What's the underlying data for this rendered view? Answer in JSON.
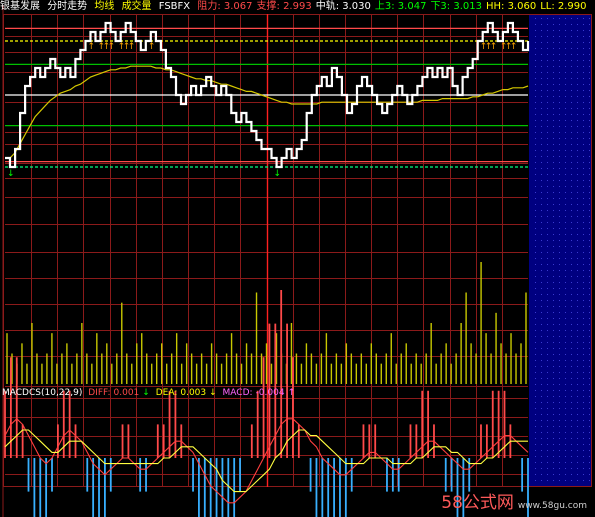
{
  "header": {
    "title": "银基发展",
    "tab_intraday": "分时走势",
    "ma_label": "均线",
    "volume_label": "成交量",
    "indicator_name": "FSBFX",
    "items": [
      {
        "label": "阻力:",
        "value": "3.067",
        "color": "#ff4a4a"
      },
      {
        "label": "支撑:",
        "value": "2.993",
        "color": "#ff4a4a"
      },
      {
        "label": "中轨:",
        "value": "3.030",
        "color": "#ffffff"
      },
      {
        "label": "上3:",
        "value": "3.047",
        "color": "#00ff00"
      },
      {
        "label": "下3:",
        "value": "3.013",
        "color": "#00ff00"
      },
      {
        "label": "HH:",
        "value": "3.060",
        "color": "#ffff00"
      },
      {
        "label": "LL:",
        "value": "2.990",
        "color": "#ffff00"
      }
    ]
  },
  "macd_header": {
    "name": "MACDCS(10,22,9)",
    "diff_label": "DIFF:",
    "diff_value": "0.001",
    "diff_arrow": "↓",
    "dea_label": "DEA:",
    "dea_value": "0.003",
    "dea_arrow": "↓",
    "macd_label": "MACD:",
    "macd_value": "-0.004",
    "macd_arrow": "↑"
  },
  "watermark": {
    "brand": "58公式网",
    "url": "www.58gu.com"
  },
  "colors": {
    "background": "#000000",
    "grid": "#8b1a1a",
    "price_line": "#ffffff",
    "avg_line": "#d4c800",
    "resistance": "#ff4a4a",
    "band": "#00c000",
    "hh_ll": "#ffff00",
    "volume": "#c8c800",
    "macd_pos": "#ff4a4a",
    "macd_neg": "#38b0ff",
    "right_panel": "#000080"
  },
  "chart_data": {
    "type": "line",
    "price_levels": {
      "resistance": 3.067,
      "support": 2.993,
      "mid": 3.03,
      "upper3": 3.047,
      "lower3": 3.013,
      "hh": 3.06,
      "ll": 2.99
    },
    "price": [
      2.995,
      2.99,
      3.0,
      3.02,
      3.035,
      3.04,
      3.045,
      3.04,
      3.045,
      3.05,
      3.045,
      3.04,
      3.045,
      3.04,
      3.05,
      3.055,
      3.06,
      3.065,
      3.06,
      3.065,
      3.07,
      3.065,
      3.06,
      3.065,
      3.07,
      3.065,
      3.06,
      3.055,
      3.06,
      3.065,
      3.06,
      3.055,
      3.045,
      3.04,
      3.03,
      3.025,
      3.03,
      3.035,
      3.03,
      3.035,
      3.04,
      3.035,
      3.03,
      3.035,
      3.03,
      3.02,
      3.015,
      3.02,
      3.015,
      3.01,
      3.005,
      3.0,
      3.0,
      2.995,
      2.99,
      2.995,
      3.0,
      2.995,
      3.0,
      3.005,
      3.02,
      3.03,
      3.035,
      3.04,
      3.035,
      3.045,
      3.04,
      3.03,
      3.02,
      3.025,
      3.035,
      3.04,
      3.035,
      3.03,
      3.025,
      3.02,
      3.025,
      3.03,
      3.035,
      3.03,
      3.025,
      3.03,
      3.035,
      3.04,
      3.045,
      3.04,
      3.045,
      3.04,
      3.045,
      3.035,
      3.03,
      3.04,
      3.045,
      3.05,
      3.06,
      3.065,
      3.07,
      3.065,
      3.06,
      3.065,
      3.07,
      3.065,
      3.06,
      3.055,
      3.06
    ],
    "avg": [
      2.995,
      2.995,
      2.998,
      3.003,
      3.008,
      3.013,
      3.018,
      3.021,
      3.024,
      3.027,
      3.029,
      3.031,
      3.032,
      3.033,
      3.035,
      3.036,
      3.038,
      3.04,
      3.041,
      3.042,
      3.043,
      3.044,
      3.044,
      3.045,
      3.045,
      3.046,
      3.046,
      3.046,
      3.046,
      3.046,
      3.045,
      3.045,
      3.044,
      3.044,
      3.043,
      3.042,
      3.041,
      3.04,
      3.039,
      3.039,
      3.038,
      3.038,
      3.037,
      3.036,
      3.036,
      3.035,
      3.034,
      3.033,
      3.032,
      3.032,
      3.031,
      3.03,
      3.029,
      3.028,
      3.027,
      3.026,
      3.026,
      3.025,
      3.025,
      3.025,
      3.025,
      3.025,
      3.025,
      3.026,
      3.026,
      3.026,
      3.026,
      3.026,
      3.026,
      3.026,
      3.026,
      3.026,
      3.026,
      3.026,
      3.026,
      3.026,
      3.026,
      3.026,
      3.026,
      3.026,
      3.026,
      3.026,
      3.026,
      3.027,
      3.027,
      3.027,
      3.027,
      3.028,
      3.028,
      3.028,
      3.028,
      3.028,
      3.028,
      3.029,
      3.029,
      3.03,
      3.031,
      3.031,
      3.032,
      3.033,
      3.033,
      3.034,
      3.034,
      3.034,
      3.035
    ],
    "volume": [
      5,
      3,
      2,
      4,
      2,
      6,
      3,
      2,
      3,
      5,
      2,
      3,
      4,
      2,
      3,
      6,
      3,
      2,
      5,
      3,
      4,
      2,
      3,
      8,
      3,
      2,
      4,
      5,
      3,
      2,
      3,
      4,
      2,
      3,
      5,
      2,
      4,
      3,
      2,
      3,
      2,
      4,
      3,
      2,
      3,
      5,
      3,
      2,
      4,
      3,
      9,
      3,
      4,
      2,
      5,
      3,
      2,
      6,
      3,
      2,
      4,
      3,
      2,
      3,
      5,
      2,
      3,
      2,
      4,
      3,
      2,
      3,
      2,
      4,
      3,
      2,
      3,
      5,
      2,
      3,
      4,
      2,
      3,
      2,
      3,
      6,
      2,
      3,
      4,
      2,
      3,
      6,
      9,
      4,
      3,
      12,
      5,
      3,
      7,
      4,
      3,
      5,
      3,
      4,
      9
    ],
    "diff": [
      0.004,
      0.006,
      0.007,
      0.006,
      0.004,
      0.002,
      0.0,
      -0.001,
      0.0,
      0.002,
      0.004,
      0.005,
      0.004,
      0.003,
      0.001,
      -0.001,
      -0.002,
      -0.003,
      -0.002,
      -0.001,
      0.0,
      0.0,
      -0.001,
      -0.002,
      -0.002,
      -0.001,
      0.0,
      0.001,
      0.002,
      0.003,
      0.003,
      0.002,
      0.001,
      -0.001,
      -0.003,
      -0.005,
      -0.006,
      -0.007,
      -0.008,
      -0.008,
      -0.007,
      -0.006,
      -0.004,
      -0.002,
      0.0,
      0.002,
      0.004,
      0.006,
      0.007,
      0.007,
      0.006,
      0.005,
      0.003,
      0.002,
      0.0,
      -0.001,
      -0.002,
      -0.003,
      -0.003,
      -0.002,
      -0.001,
      0.0,
      0.001,
      0.001,
      0.0,
      -0.001,
      -0.002,
      -0.002,
      -0.001,
      0.0,
      0.001,
      0.002,
      0.003,
      0.003,
      0.002,
      0.001,
      0.0,
      -0.001,
      -0.002,
      -0.002,
      -0.001,
      0.0,
      0.001,
      0.002,
      0.003,
      0.004,
      0.004,
      0.003,
      0.002,
      0.001
    ],
    "dea": [
      0.002,
      0.003,
      0.004,
      0.005,
      0.005,
      0.004,
      0.003,
      0.002,
      0.001,
      0.001,
      0.002,
      0.003,
      0.003,
      0.003,
      0.002,
      0.001,
      0.0,
      -0.001,
      -0.001,
      -0.001,
      -0.001,
      -0.001,
      -0.001,
      -0.001,
      -0.001,
      -0.001,
      -0.001,
      0.0,
      0.0,
      0.001,
      0.002,
      0.002,
      0.002,
      0.001,
      0.0,
      -0.001,
      -0.002,
      -0.004,
      -0.005,
      -0.006,
      -0.006,
      -0.006,
      -0.005,
      -0.004,
      -0.003,
      -0.002,
      0.0,
      0.001,
      0.003,
      0.004,
      0.005,
      0.005,
      0.004,
      0.004,
      0.003,
      0.002,
      0.001,
      0.0,
      -0.001,
      -0.001,
      -0.001,
      -0.001,
      0.0,
      0.0,
      0.0,
      0.0,
      -0.001,
      -0.001,
      -0.001,
      -0.001,
      0.0,
      0.0,
      0.001,
      0.002,
      0.002,
      0.002,
      0.001,
      0.001,
      0.0,
      -0.001,
      -0.001,
      -0.001,
      0.0,
      0.0,
      0.001,
      0.002,
      0.003,
      0.003,
      0.003,
      0.003
    ],
    "ylim_price": [
      2.985,
      3.075
    ]
  }
}
